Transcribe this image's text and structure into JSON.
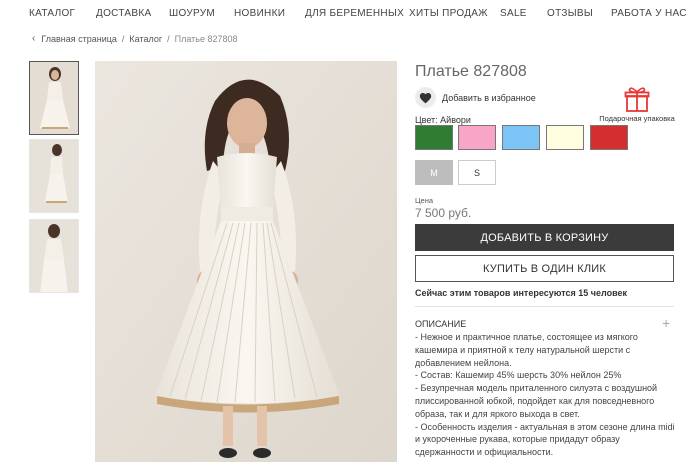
{
  "nav": {
    "items": [
      "КАТАЛОГ",
      "ДОСТАВКА",
      "ШОУРУМ",
      "НОВИНКИ",
      "ДЛЯ БЕРЕМЕННЫХ",
      "ХИТЫ ПРОДАЖ",
      "SALE",
      "ОТЗЫВЫ",
      "РАБОТА У НАС"
    ]
  },
  "breadcrumb": {
    "home": "Главная страница",
    "catalog": "Каталог",
    "current": "Платье 827808",
    "separator": "/"
  },
  "product": {
    "title": "Платье 827808",
    "favorite_label": "Добавить в избранное",
    "gift_label": "Подарочная упаковка",
    "color_label": "Цвет: Айвори",
    "colors": [
      "#2e7d32",
      "#f8a5c8",
      "#7cc3f6",
      "#fffde0",
      "#d32f2f"
    ],
    "sizes": [
      "M",
      "S"
    ],
    "selected_size": "M",
    "price_label": "Цена",
    "price": "7 500 руб.",
    "add_to_cart": "ДОБАВИТЬ В КОРЗИНУ",
    "buy_one_click": "КУПИТЬ В ОДИН КЛИК",
    "interest_text": "Сейчас этим товаров интересуются 15 человек"
  },
  "description": {
    "heading": "ОПИСАНИЕ",
    "expand_symbol": "+",
    "lines": [
      "- Нежное и практичное платье, состоящее из мягкого кашемира и приятной к телу натуральной шерсти с добавлением нейлона.",
      "- Состав: Кашемир 45% шерсть 30% нейлон 25%",
      "- Безупречная модель приталенного силуэта с воздушной плиссированной юбкой, подойдет как для повседневного образа, так и для яркого выхода в свет.",
      "- Особенность изделия - актуальная в этом сезоне длина midi и укороченные рукава, которые придадут образу сдержанности и официальности."
    ]
  },
  "icons": {
    "favorite": "heart-icon",
    "gift": "gift-box-icon",
    "breadcrumb_back": "chevron-left-icon",
    "expand": "plus-icon"
  }
}
